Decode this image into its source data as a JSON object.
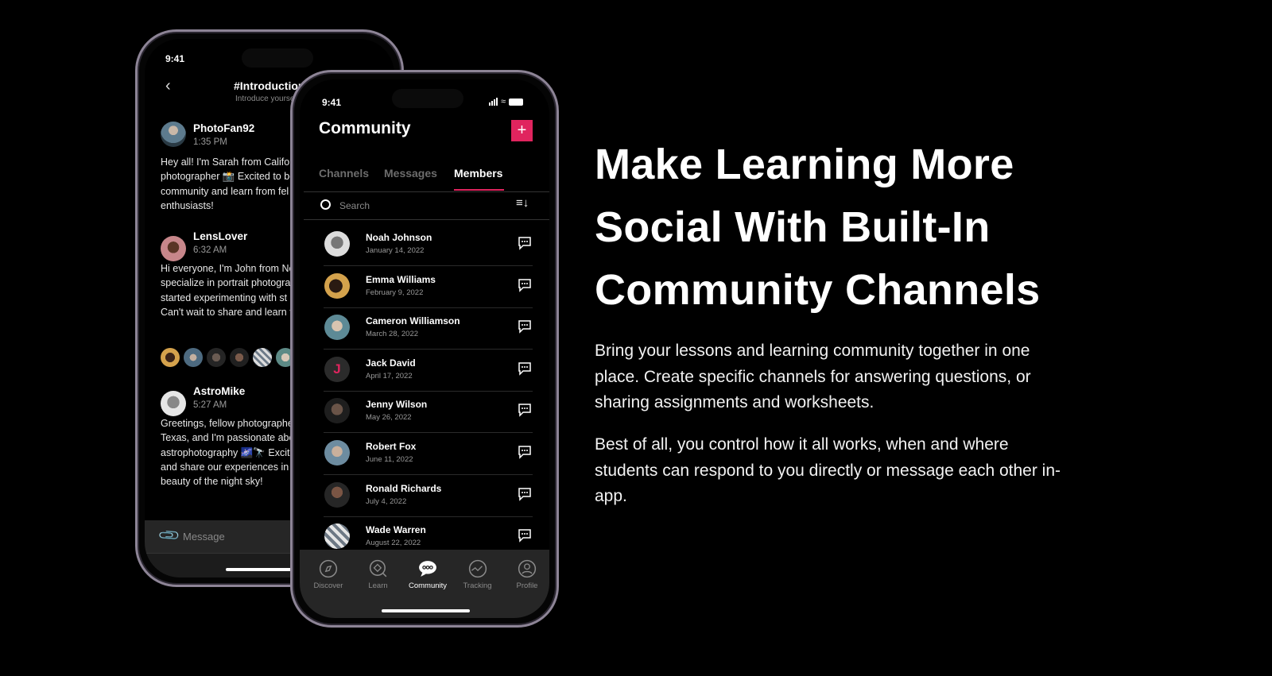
{
  "back_phone": {
    "status_time": "9:41",
    "channel_title": "#Introductions",
    "channel_subtitle": "Introduce yoursel",
    "messages": [
      {
        "user": "PhotoFan92",
        "time": "1:35 PM",
        "lines": [
          "Hey all! I'm Sarah from Califor",
          "photographer 📸 Excited to be",
          "community and learn from fel",
          "enthusiasts!"
        ]
      },
      {
        "user": "LensLover",
        "time": "6:32 AM",
        "lines": [
          "Hi everyone, I'm John from Ne",
          "specialize in portrait photogra",
          "started experimenting with st",
          "Can't wait to share and learn f"
        ]
      },
      {
        "user": "AstroMike",
        "time": "5:27 AM",
        "lines": [
          "Greetings, fellow photographe",
          "Texas, and I'm passionate abo",
          "astrophotography 🌌🔭 Excite",
          "and share our experiences in",
          "beauty of the night sky!"
        ]
      }
    ],
    "composer_placeholder": "Message"
  },
  "front_phone": {
    "status_time": "9:41",
    "title": "Community",
    "add_label": "+",
    "tabs": [
      {
        "label": "Channels",
        "active": false
      },
      {
        "label": "Messages",
        "active": false
      },
      {
        "label": "Members",
        "active": true
      }
    ],
    "search_placeholder": "Search",
    "members": [
      {
        "name": "Noah Johnson",
        "date": "January 14, 2022"
      },
      {
        "name": "Emma Williams",
        "date": "February 9, 2022"
      },
      {
        "name": "Cameron Williamson",
        "date": "March 28, 2022"
      },
      {
        "name": "Jack David",
        "date": "April 17, 2022",
        "initial": "J"
      },
      {
        "name": "Jenny Wilson",
        "date": "May 26, 2022"
      },
      {
        "name": "Robert Fox",
        "date": "June 11, 2022"
      },
      {
        "name": "Ronald Richards",
        "date": "July 4, 2022"
      },
      {
        "name": "Wade Warren",
        "date": "August 22, 2022"
      }
    ],
    "nav": [
      {
        "label": "Discover",
        "icon": "compass-icon",
        "active": false
      },
      {
        "label": "Learn",
        "icon": "learn-search-icon",
        "active": false
      },
      {
        "label": "Community",
        "icon": "chat-bubble-icon",
        "active": true
      },
      {
        "label": "Tracking",
        "icon": "tracking-chart-icon",
        "active": false
      },
      {
        "label": "Profile",
        "icon": "profile-icon",
        "active": false
      }
    ]
  },
  "colors": {
    "accent": "#e0245e",
    "background": "#000000",
    "tabbar": "#262626"
  },
  "marketing": {
    "heading_lines": [
      "Make Learning More",
      "Social With Built-In",
      "Community Channels"
    ],
    "paragraph1": "Bring your lessons and learning community together in one place. Create specific channels for answering questions, or sharing assignments and worksheets.",
    "paragraph2": "Best of all, you control how it all works, when and where students can respond to you directly or message each other in-app."
  }
}
